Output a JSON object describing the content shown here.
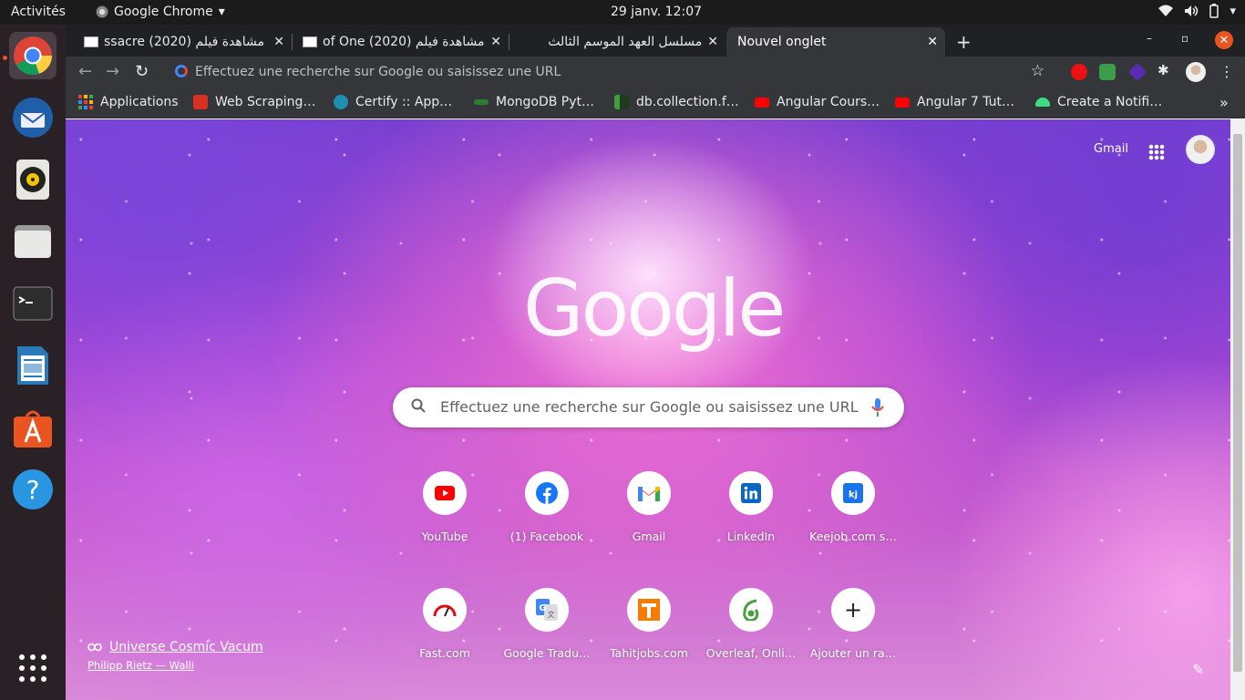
{
  "topbar": {
    "activities": "Activités",
    "app_name": "Google Chrome",
    "clock": "29 janv.  12:07"
  },
  "tabs": [
    {
      "title": "ssacre (2020) مشاهدة فيلم",
      "close": "✕"
    },
    {
      "title": "of One (2020) مشاهدة فيلم",
      "close": "✕"
    },
    {
      "title": "مسلسل العهد الموسم الثالث",
      "close": "✕"
    },
    {
      "title": "Nouvel onglet",
      "close": "✕",
      "active": true
    }
  ],
  "omnibox": {
    "placeholder": "Effectuez une recherche sur Google ou saisissez une URL"
  },
  "bookmarks": [
    {
      "label": "Applications",
      "icon": "apps-grid-icon",
      "color": "#e94235"
    },
    {
      "label": "Web Scraping…",
      "icon": "scraping-icon",
      "color": "#d93025"
    },
    {
      "label": "Certify :: App…",
      "icon": "certify-icon",
      "color": "#1e8fb1"
    },
    {
      "label": "MongoDB Pyt…",
      "icon": "mongodb-icon",
      "color": "#2e7d32"
    },
    {
      "label": "db.collection.f…",
      "icon": "mongodb-leaf-icon",
      "color": "#3fa037"
    },
    {
      "label": "Angular Cours…",
      "icon": "youtube-icon",
      "color": "#ff0000"
    },
    {
      "label": "Angular 7 Tut…",
      "icon": "youtube-icon",
      "color": "#ff0000"
    },
    {
      "label": "Create a Notifi…",
      "icon": "android-icon",
      "color": "#3ddc84"
    }
  ],
  "ntp": {
    "gmail": "Gmail",
    "logo": "Google",
    "search_placeholder": "Effectuez une recherche sur Google ou saisissez une URL",
    "shortcuts_row1": [
      {
        "label": "YouTube",
        "icon": "youtube-icon",
        "color": "#ff0000"
      },
      {
        "label": "(1) Facebook",
        "icon": "facebook-icon",
        "color": "#1877f2"
      },
      {
        "label": "Gmail",
        "icon": "gmail-icon",
        "color": "#ea4335"
      },
      {
        "label": "LinkedIn",
        "icon": "linkedin-icon",
        "color": "#0a66c2"
      },
      {
        "label": "Keejob.com s…",
        "icon": "keejob-icon",
        "color": "#1a73e8"
      }
    ],
    "shortcuts_row2": [
      {
        "label": "Fast.com",
        "icon": "fast-speed-icon",
        "color": "#e50914"
      },
      {
        "label": "Google Tradu…",
        "icon": "google-translate-icon",
        "color": "#4285f4"
      },
      {
        "label": "Tahitjobs.com",
        "icon": "tahitjobs-icon",
        "color": "#f57c00"
      },
      {
        "label": "Overleaf, Onli…",
        "icon": "overleaf-icon",
        "color": "#47a141"
      },
      {
        "label": "Ajouter un ra…",
        "icon": "plus-icon",
        "color": "#202124"
      }
    ],
    "attribution_title": "Universe Cosmic Vacum",
    "attribution_author": "Philipp Rietz — Walli"
  }
}
